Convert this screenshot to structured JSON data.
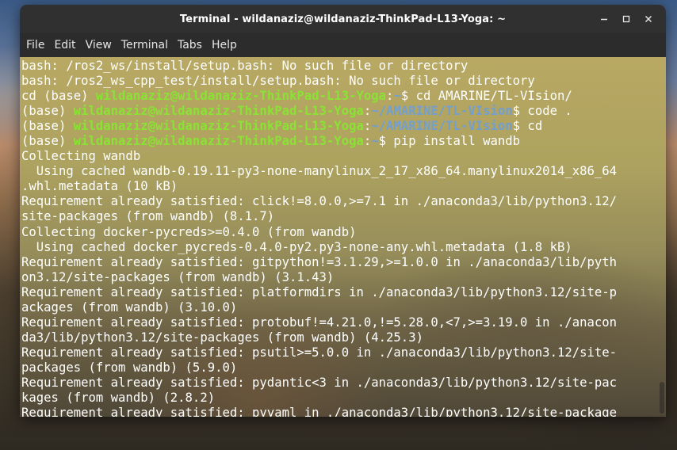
{
  "window": {
    "title": "Terminal - wildanaziz@wildanaziz-ThinkPad-L13-Yoga: ~"
  },
  "menu": [
    "File",
    "Edit",
    "View",
    "Terminal",
    "Tabs",
    "Help"
  ],
  "icons": {
    "minimize": "minimize-icon",
    "maximize": "maximize-icon",
    "close": "close-icon"
  },
  "colors": {
    "user_prompt": "#8ae234",
    "path_prompt": "#729fcf",
    "titlebar": "#303030",
    "menubar": "#2c2c2c"
  },
  "lines": [
    {
      "text": "bash: /ros2_ws/install/setup.bash: No such file or directory"
    },
    {
      "text": "bash: /ros2_ws_cpp_test/install/setup.bash: No such file or directory"
    },
    {
      "prefix": "cd (base) ",
      "user": "wildanaziz@wildanaziz-ThinkPad-L13-Yoga",
      "sep": ":",
      "path": "~",
      "cmd": "$ cd AMARINE/TL-VIsion/"
    },
    {
      "prefix": "(base) ",
      "user": "wildanaziz@wildanaziz-ThinkPad-L13-Yoga",
      "sep": ":",
      "path": "~/AMARINE/TL-VIsion",
      "cmd": "$ code ."
    },
    {
      "prefix": "(base) ",
      "user": "wildanaziz@wildanaziz-ThinkPad-L13-Yoga",
      "sep": ":",
      "path": "~/AMARINE/TL-VIsion",
      "cmd": "$ cd"
    },
    {
      "prefix": "(base) ",
      "user": "wildanaziz@wildanaziz-ThinkPad-L13-Yoga",
      "sep": ":",
      "path": "~",
      "cmd": "$ pip install wandb"
    },
    {
      "text": "Collecting wandb"
    },
    {
      "text": "  Using cached wandb-0.19.11-py3-none-manylinux_2_17_x86_64.manylinux2014_x86_64"
    },
    {
      "text": ".whl.metadata (10 kB)"
    },
    {
      "text": "Requirement already satisfied: click!=8.0.0,>=7.1 in ./anaconda3/lib/python3.12/"
    },
    {
      "text": "site-packages (from wandb) (8.1.7)"
    },
    {
      "text": "Collecting docker-pycreds>=0.4.0 (from wandb)"
    },
    {
      "text": "  Using cached docker_pycreds-0.4.0-py2.py3-none-any.whl.metadata (1.8 kB)"
    },
    {
      "text": "Requirement already satisfied: gitpython!=3.1.29,>=1.0.0 in ./anaconda3/lib/pyth"
    },
    {
      "text": "on3.12/site-packages (from wandb) (3.1.43)"
    },
    {
      "text": "Requirement already satisfied: platformdirs in ./anaconda3/lib/python3.12/site-p"
    },
    {
      "text": "ackages (from wandb) (3.10.0)"
    },
    {
      "text": "Requirement already satisfied: protobuf!=4.21.0,!=5.28.0,<7,>=3.19.0 in ./anacon"
    },
    {
      "text": "da3/lib/python3.12/site-packages (from wandb) (4.25.3)"
    },
    {
      "text": "Requirement already satisfied: psutil>=5.0.0 in ./anaconda3/lib/python3.12/site-"
    },
    {
      "text": "packages (from wandb) (5.9.0)"
    },
    {
      "text": "Requirement already satisfied: pydantic<3 in ./anaconda3/lib/python3.12/site-pac"
    },
    {
      "text": "kages (from wandb) (2.8.2)"
    },
    {
      "text": "Requirement already satisfied: pyyaml in ./anaconda3/lib/python3.12/site-package"
    }
  ]
}
